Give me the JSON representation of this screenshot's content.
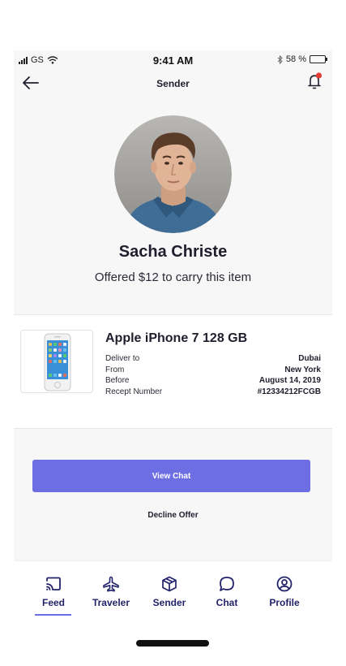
{
  "status_bar": {
    "carrier": "GS",
    "time": "9:41 AM",
    "battery": "58 %",
    "battery_level": 0.58
  },
  "nav": {
    "title": "Sender",
    "back_icon": "arrow-left-icon",
    "notification_icon": "bell-icon",
    "notification_dot_color": "#e53935"
  },
  "profile": {
    "name": "Sacha Christe",
    "offer_text": "Offered $12 to carry this item"
  },
  "item": {
    "title": "Apple iPhone 7 128 GB",
    "details": [
      {
        "label": "Deliver to",
        "value": "Dubai"
      },
      {
        "label": "From",
        "value": "New York"
      },
      {
        "label": "Before",
        "value": "August 14, 2019"
      },
      {
        "label": "Recept Number",
        "value": "#12334212FCGB"
      }
    ]
  },
  "actions": {
    "view_chat": "View Chat",
    "decline": "Decline Offer"
  },
  "tabs": [
    {
      "label": "Feed",
      "icon": "cast-icon",
      "active": true
    },
    {
      "label": "Traveler",
      "icon": "airplane-icon",
      "active": false
    },
    {
      "label": "Sender",
      "icon": "package-icon",
      "active": false
    },
    {
      "label": "Chat",
      "icon": "chat-bubble-icon",
      "active": false
    },
    {
      "label": "Profile",
      "icon": "user-circle-icon",
      "active": false
    }
  ],
  "colors": {
    "accent": "#6d6de4",
    "tab_label": "#23236b",
    "text_primary": "#1e1e2d"
  }
}
